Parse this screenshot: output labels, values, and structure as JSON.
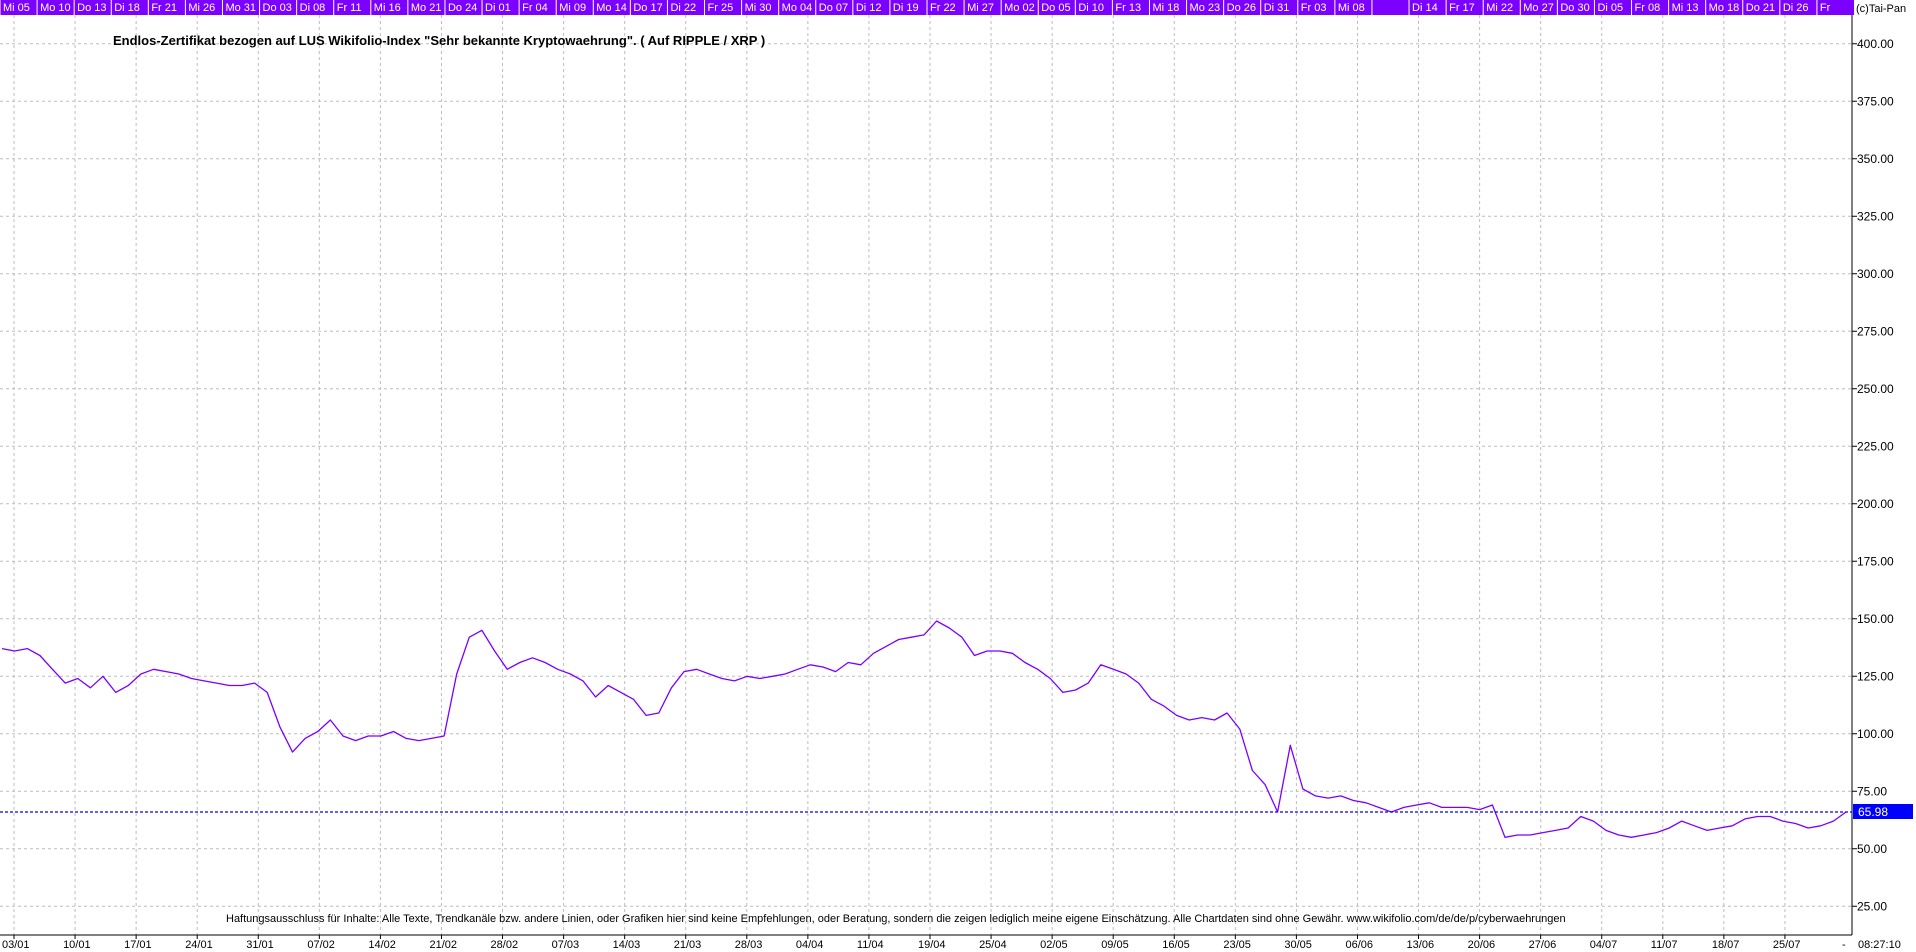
{
  "copyright": "(c)Tai-Pan",
  "last_value_label": "65.98",
  "time_label": "08:27:10",
  "corner_dash": "-",
  "colors": {
    "line": "#7b00ff",
    "day_strip": "#7b00ff",
    "last_line": "#0000ff",
    "grid": "#bdbdbd",
    "last_label_bg": "#0000ff"
  },
  "top_day_labels": [
    "Mi 05",
    "Mo 10",
    "Do 13",
    "Di 18",
    "Fr 21",
    "Mi 26",
    "Mo 31",
    "Do 03",
    "Di 08",
    "Fr 11",
    "Mi 16",
    "Mo 21",
    "Do 24",
    "Di 01",
    "Fr 04",
    "Mi 09",
    "Mo 14",
    "Do 17",
    "Di 22",
    "Fr 25",
    "Mi 30",
    "Mo 04",
    "Do 07",
    "Di 12",
    "Di 19",
    "Fr 22",
    "Mi 27",
    "Mo 02",
    "Do 05",
    "Di 10",
    "Fr 13",
    "Mi 18",
    "Mo 23",
    "Do 26",
    "Di 31",
    "Fr 03",
    "Mi 08",
    "",
    "Di 14",
    "Fr 17",
    "Mi 22",
    "Mo 27",
    "Do 30",
    "Di 05",
    "Fr 08",
    "Mi 13",
    "Mo 18",
    "Do 21",
    "Di 26",
    "Fr"
  ],
  "chart_data": {
    "type": "line",
    "title": "Endlos-Zertifikat bezogen auf LUS Wikifolio-Index \"Sehr bekannte Kryptowaehrung\". ( Auf RIPPLE / XRP )",
    "footnote": "Haftungsausschluss für Inhalte: Alle Texte, Trendkanäle bzw. andere Linien, oder Grafiken hier sind keine Empfehlungen, oder Beratung, sondern die zeigen lediglich meine eigene Einschätzung. Alle Chartdaten sind ohne Gewähr.  www.wikifolio.com/de/de/p/cyberwaehrungen",
    "xlabel": "",
    "ylabel": "",
    "ylim": [
      12.5,
      412.5
    ],
    "y_ticks": [
      25,
      50,
      75,
      100,
      125,
      150,
      175,
      200,
      225,
      250,
      275,
      300,
      325,
      350,
      375,
      400
    ],
    "y_tick_labels": [
      "25.00",
      "50.00",
      "75.00",
      "100.00",
      "125.00",
      "150.00",
      "175.00",
      "200.00",
      "225.00",
      "250.00",
      "275.00",
      "300.00",
      "325.00",
      "350.00",
      "375.00",
      "400.00"
    ],
    "x_tick_labels": [
      "03/01",
      "10/01",
      "17/01",
      "24/01",
      "31/01",
      "07/02",
      "14/02",
      "21/02",
      "28/02",
      "07/03",
      "14/03",
      "21/03",
      "28/03",
      "04/04",
      "11/04",
      "19/04",
      "25/04",
      "02/05",
      "09/05",
      "16/05",
      "23/05",
      "30/05",
      "06/06",
      "13/06",
      "20/06",
      "27/06",
      "04/07",
      "11/07",
      "18/07",
      "25/07"
    ],
    "grid": true,
    "last_value": 65.98,
    "series": [
      {
        "values": [
          137,
          136,
          137,
          134,
          128,
          122,
          124,
          120,
          125,
          118,
          121,
          126,
          128,
          127,
          126,
          124,
          123,
          122,
          121,
          121,
          122,
          118,
          103,
          92,
          98,
          101,
          106,
          99,
          97,
          99,
          99,
          101,
          98,
          97,
          98,
          99,
          126,
          142,
          145,
          136,
          128,
          131,
          133,
          131,
          128,
          126,
          123,
          116,
          121,
          118,
          115,
          108,
          109,
          120,
          127,
          128,
          126,
          124,
          123,
          125,
          124,
          125,
          126,
          128,
          130,
          129,
          127,
          131,
          130,
          135,
          138,
          141,
          142,
          143,
          149,
          146,
          142,
          134,
          136,
          136,
          135,
          131,
          128,
          124,
          118,
          119,
          122,
          130,
          128,
          126,
          122,
          115,
          112,
          108,
          106,
          107,
          106,
          109,
          102,
          84,
          78,
          66,
          95,
          76,
          73,
          72,
          73,
          71,
          70,
          68,
          66,
          68,
          69,
          70,
          68,
          68,
          68,
          67,
          69,
          55,
          56,
          56,
          57,
          58,
          59,
          64,
          62,
          58,
          56,
          55,
          56,
          57,
          59,
          62,
          60,
          58,
          59,
          60,
          63,
          64,
          64,
          62,
          61,
          59,
          60,
          62,
          66
        ]
      }
    ]
  }
}
